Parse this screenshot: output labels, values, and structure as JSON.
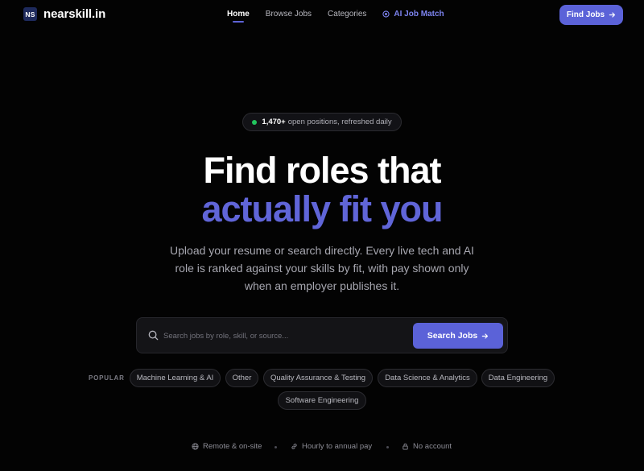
{
  "nav": {
    "logo_text": "NS",
    "brand": "nearskill.in",
    "links": [
      {
        "label": "Home"
      },
      {
        "label": "Browse Jobs"
      },
      {
        "label": "Categories"
      },
      {
        "label": "AI Job Match"
      }
    ],
    "cta_label": "Find Jobs"
  },
  "hero": {
    "pill_count": "1,470+",
    "pill_text": "open positions, refreshed daily",
    "headline_line1": "Find roles that",
    "headline_line2": "actually fit you",
    "subtitle": "Upload your resume or search directly. Every live tech and AI role is ranked against your skills by fit, with pay shown only when an employer publishes it."
  },
  "search": {
    "placeholder": "Search jobs by role, skill, or source...",
    "value": "",
    "button_label": "Search Jobs"
  },
  "popular": {
    "label": "POPULAR",
    "tags": [
      "Machine Learning & AI",
      "Other",
      "Quality Assurance & Testing",
      "Data Science & Analytics",
      "Data Engineering",
      "Software Engineering"
    ]
  },
  "features": [
    {
      "icon": "globe-icon",
      "label": "Remote & on-site"
    },
    {
      "icon": "link-icon",
      "label": "Hourly to annual pay"
    },
    {
      "icon": "lock-icon",
      "label": "No account"
    }
  ],
  "colors": {
    "accent": "#5b62d8",
    "accent_text": "#6065d8",
    "background": "#030303",
    "status_dot": "#22c55e"
  }
}
